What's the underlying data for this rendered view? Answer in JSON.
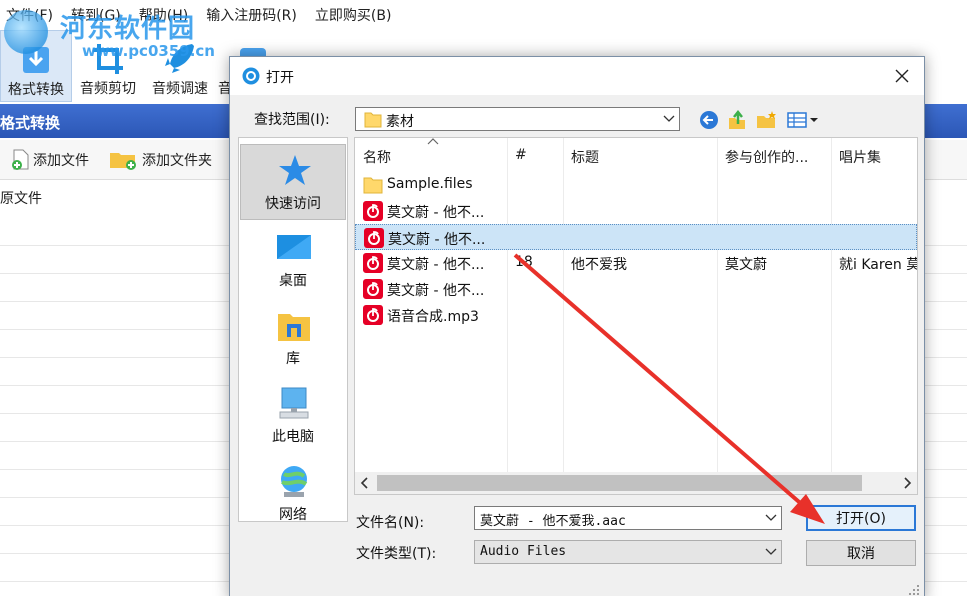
{
  "menu": [
    "文件(F)",
    "转到(G)",
    "帮助(H)",
    "输入注册码(R)",
    "立即购买(B)"
  ],
  "watermark": {
    "title": "河东软件园",
    "url": "www.pc0359.cn"
  },
  "toolbar": {
    "items": [
      {
        "label": "格式转换",
        "icon": "format-convert-icon"
      },
      {
        "label": "音频剪切",
        "icon": "crop-icon"
      },
      {
        "label": "音频调速",
        "icon": "rocket-icon"
      },
      {
        "label": "音",
        "icon": "audio-icon"
      }
    ]
  },
  "panel": {
    "title": "格式转换",
    "add_file": "添加文件",
    "add_folder": "添加文件夹",
    "source_header": "原文件"
  },
  "dialog": {
    "title": "打开",
    "look_in_label": "查找范围(I):",
    "look_in_value": "素材",
    "places": [
      {
        "label": "快速访问",
        "icon": "star-icon"
      },
      {
        "label": "桌面",
        "icon": "desktop-icon"
      },
      {
        "label": "库",
        "icon": "library-icon"
      },
      {
        "label": "此电脑",
        "icon": "computer-icon"
      },
      {
        "label": "网络",
        "icon": "network-icon"
      }
    ],
    "columns": [
      "名称",
      "#",
      "标题",
      "参与创作的...",
      "唱片集"
    ],
    "files": [
      {
        "name": "Sample.files",
        "type": "folder",
        "num": "",
        "title": "",
        "artist": "",
        "album": ""
      },
      {
        "name": "莫文蔚 - 他不...",
        "type": "audio",
        "num": "",
        "title": "",
        "artist": "",
        "album": ""
      },
      {
        "name": "莫文蔚 - 他不...",
        "type": "audio",
        "num": "",
        "title": "",
        "artist": "",
        "album": "",
        "selected": true
      },
      {
        "name": "莫文蔚 - 他不...",
        "type": "audio",
        "num": "18",
        "title": "他不爱我",
        "artist": "莫文蔚",
        "album": "就i Karen 莫"
      },
      {
        "name": "莫文蔚 - 他不...",
        "type": "audio",
        "num": "",
        "title": "",
        "artist": "",
        "album": ""
      },
      {
        "name": "语音合成.mp3",
        "type": "audio",
        "num": "",
        "title": "",
        "artist": "",
        "album": ""
      }
    ],
    "filename_label": "文件名(N):",
    "filename_value": "莫文蔚 - 他不爱我.aac",
    "filetype_label": "文件类型(T):",
    "filetype_value": "Audio Files",
    "open_button": "打开(O)",
    "cancel_button": "取消"
  },
  "colors": {
    "accent": "#2b78d6",
    "panel_header": "#2c57b6",
    "annotation_arrow": "#e8312a",
    "netease_red": "#e60026"
  }
}
